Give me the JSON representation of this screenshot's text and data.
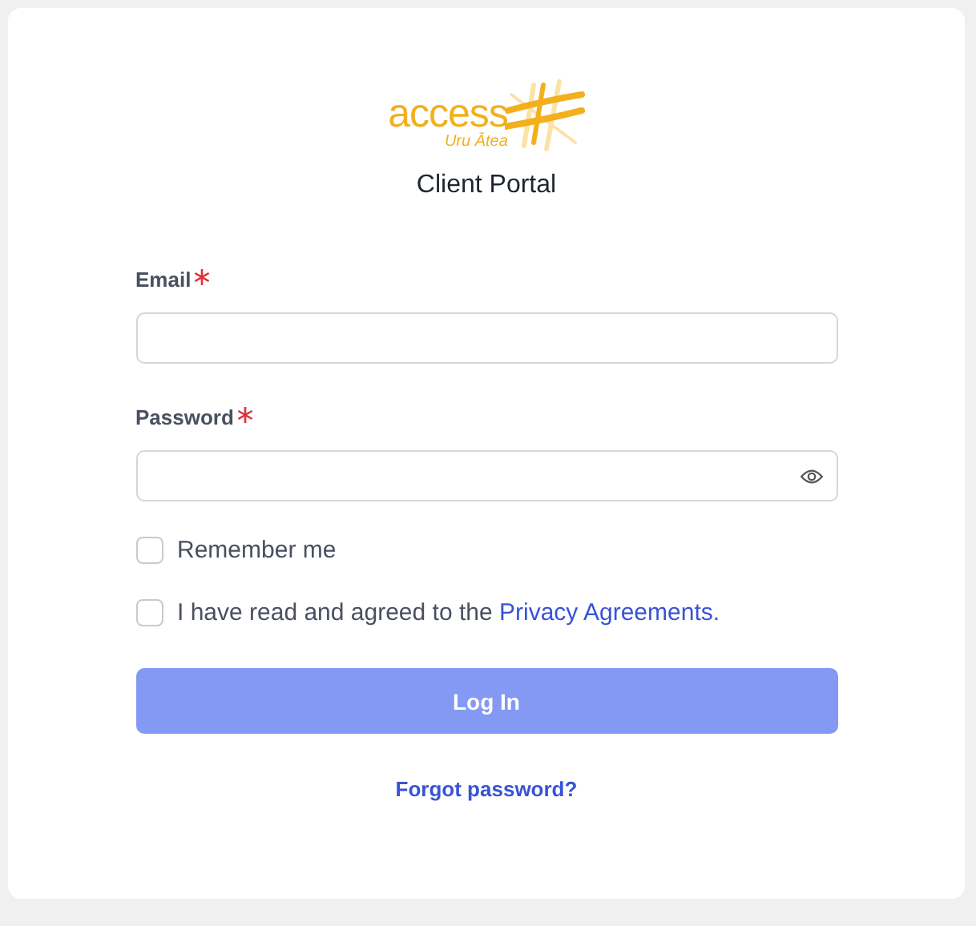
{
  "logo": {
    "wordmark": "access",
    "tagline": "Uru Ātea"
  },
  "title": "Client Portal",
  "fields": [
    {
      "label": "Email",
      "required": true,
      "kind": "text"
    },
    {
      "label": "Password",
      "required": true,
      "kind": "password"
    }
  ],
  "checkboxes": [
    {
      "label": "Remember me",
      "checked": false
    },
    {
      "label": "I have read and agreed to the ",
      "link": "Privacy Agreements.",
      "checked": false
    }
  ],
  "login_button": {
    "label": "Log In",
    "disabled": true
  },
  "forgot_link": "Forgot password?"
}
